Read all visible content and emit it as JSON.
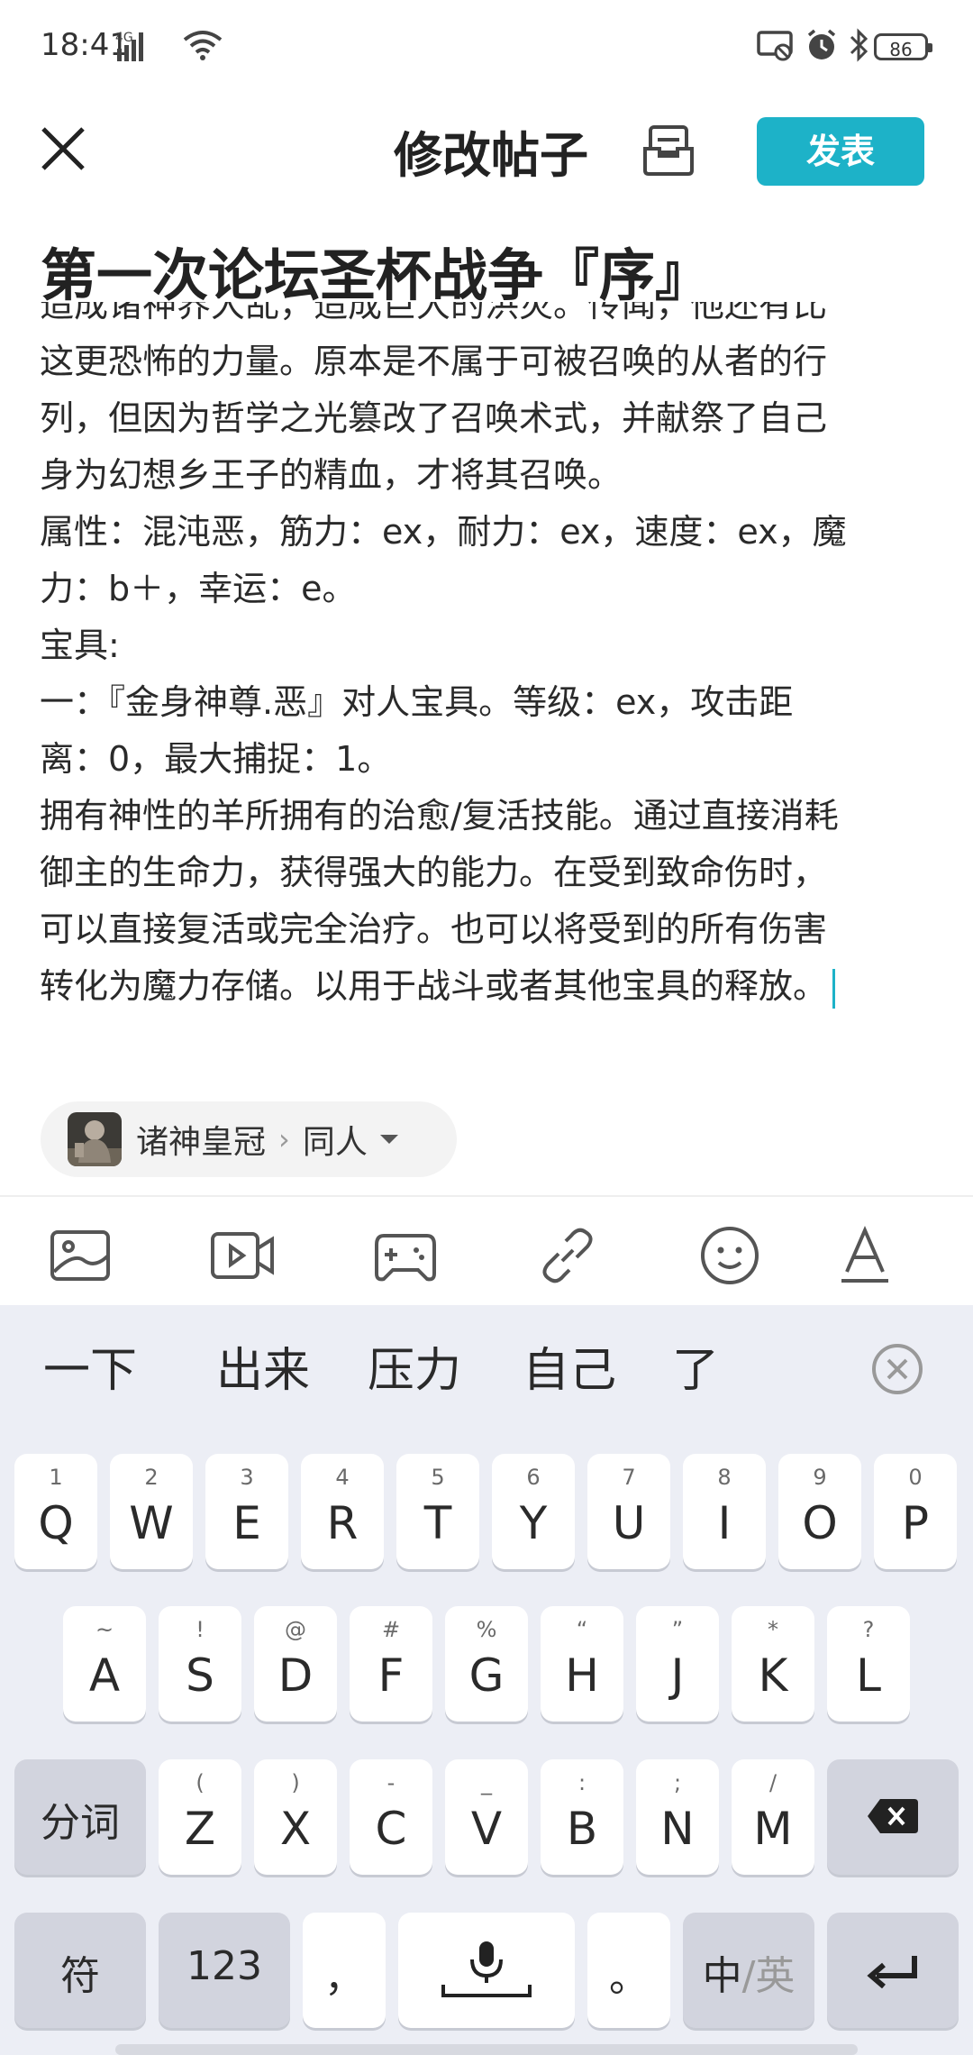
{
  "status_bar": {
    "time": "18:41",
    "network": "4G",
    "battery": "86",
    "icons": [
      "signal-icon",
      "wifi-icon",
      "screen-cast-icon",
      "alarm-icon",
      "bluetooth-icon",
      "battery-icon"
    ]
  },
  "header": {
    "title": "修改帖子",
    "publish_label": "发表",
    "close_icon": "close-icon",
    "draft_icon": "draft-box-icon"
  },
  "post": {
    "title": "第一次论坛圣杯战争『序』",
    "body_lines": [
      "造成诸神界大乱，造成巨大的洪灾。传闻，他还有比",
      "这更恐怖的力量。原本是不属于可被召唤的从者的行",
      "列，但因为哲学之光篡改了召唤术式，并献祭了自己",
      "身为幻想乡王子的精血，才将其召唤。",
      "属性：混沌恶，筋力：ex，耐力：ex，速度：ex，魔",
      "力：b＋，幸运：e。",
      "宝具:",
      "一：『金身神尊.恶』对人宝具。等级：ex，攻击距",
      "离：0，最大捕捉：1。",
      "拥有神性的羊所拥有的治愈/复活技能。通过直接消耗",
      "御主的生命力，获得强大的能力。在受到致命伤时，",
      "可以直接复活或完全治疗。也可以将受到的所有伤害",
      "转化为魔力存储。以用于战斗或者其他宝具的释放。"
    ]
  },
  "forum_chip": {
    "forum": "诸神皇冠",
    "separator": "›",
    "category": "同人"
  },
  "toolbar": [
    "image-icon",
    "video-icon",
    "game-controller-icon",
    "link-icon",
    "emoji-icon",
    "text-format-icon"
  ],
  "keyboard": {
    "candidates": [
      "一下",
      "出来",
      "压力",
      "自己",
      "了"
    ],
    "row1": [
      {
        "num": "1",
        "key": "Q"
      },
      {
        "num": "2",
        "key": "W"
      },
      {
        "num": "3",
        "key": "E"
      },
      {
        "num": "4",
        "key": "R"
      },
      {
        "num": "5",
        "key": "T"
      },
      {
        "num": "6",
        "key": "Y"
      },
      {
        "num": "7",
        "key": "U"
      },
      {
        "num": "8",
        "key": "I"
      },
      {
        "num": "9",
        "key": "O"
      },
      {
        "num": "0",
        "key": "P"
      }
    ],
    "row2": [
      {
        "num": "~",
        "key": "A"
      },
      {
        "num": "!",
        "key": "S"
      },
      {
        "num": "@",
        "key": "D"
      },
      {
        "num": "#",
        "key": "F"
      },
      {
        "num": "%",
        "key": "G"
      },
      {
        "num": "“",
        "key": "H"
      },
      {
        "num": "”",
        "key": "J"
      },
      {
        "num": "*",
        "key": "K"
      },
      {
        "num": "?",
        "key": "L"
      }
    ],
    "row3_left": "分词",
    "row3": [
      {
        "num": "(",
        "key": "Z"
      },
      {
        "num": ")",
        "key": "X"
      },
      {
        "num": "-",
        "key": "C"
      },
      {
        "num": "_",
        "key": "V"
      },
      {
        "num": ":",
        "key": "B"
      },
      {
        "num": ";",
        "key": "N"
      },
      {
        "num": "/",
        "key": "M"
      }
    ],
    "row4": {
      "symbols": "符",
      "numbers": "123",
      "comma": "，",
      "period": "。",
      "lang_cn": "中",
      "lang_sep": "/",
      "lang_en": "英"
    }
  }
}
